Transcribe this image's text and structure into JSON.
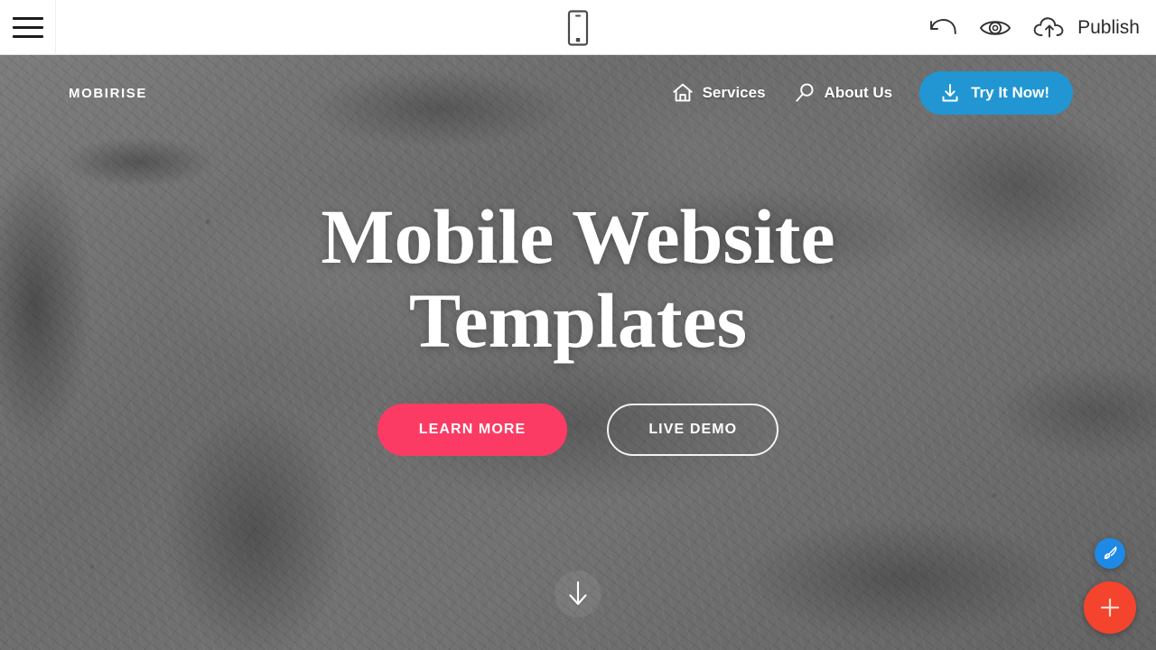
{
  "editor_bar": {
    "menu_button": {
      "name": "menu",
      "label": ""
    },
    "device_preview": {
      "name": "mobile-preview",
      "label": ""
    },
    "undo": {
      "name": "undo",
      "label": ""
    },
    "preview": {
      "name": "preview-eye",
      "label": ""
    },
    "publish": {
      "label": "Publish",
      "icon": "cloud-upload-icon"
    }
  },
  "site": {
    "brand": "MOBIRISE",
    "nav_links": [
      {
        "label": "Services",
        "icon": "home-icon"
      },
      {
        "label": "About Us",
        "icon": "search-icon"
      }
    ],
    "cta": {
      "label": "Try It Now!",
      "icon": "download-icon",
      "color": "#2196d3"
    }
  },
  "hero": {
    "title_line1": "Mobile Website",
    "title_line2": "Templates",
    "buttons": [
      {
        "label": "LEARN MORE",
        "style": "primary",
        "color": "#fb3b63"
      },
      {
        "label": "LIVE DEMO",
        "style": "ghost",
        "color": "#ffffff"
      }
    ],
    "scroll_indicator": "down-arrow-icon"
  },
  "floating_actions": [
    {
      "name": "style-fab",
      "icon": "paintbrush-icon",
      "color": "#1e8ae5"
    },
    {
      "name": "add-block-fab",
      "icon": "plus-icon",
      "color": "#f4442e"
    }
  ]
}
